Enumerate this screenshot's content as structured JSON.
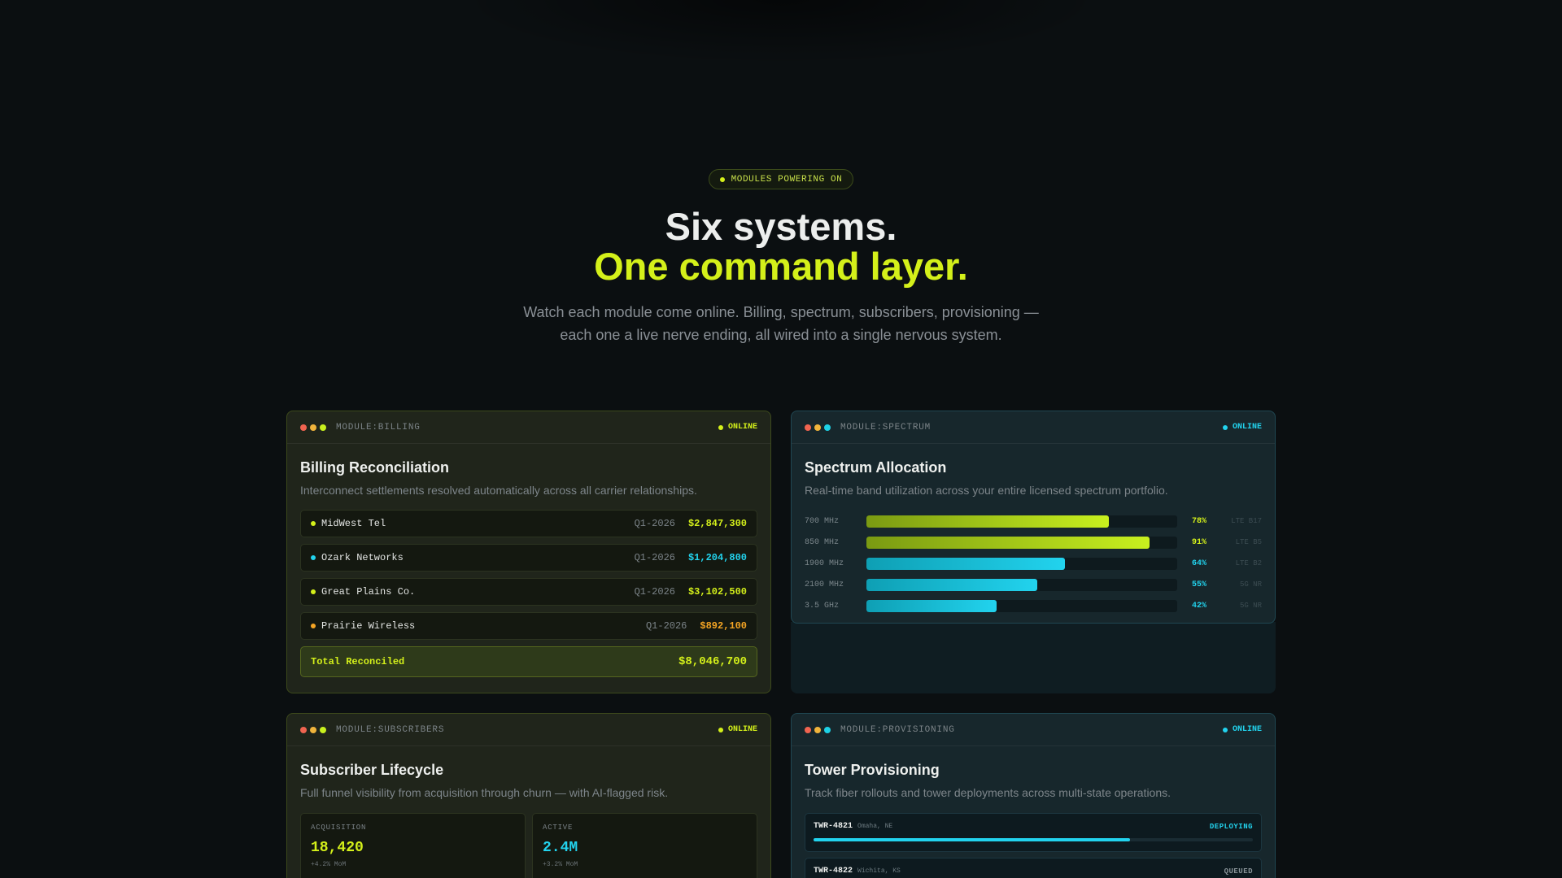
{
  "hero": {
    "pill": "MODULES POWERING ON",
    "title_line1": "Six systems.",
    "title_line2": "One command layer.",
    "subtitle": "Watch each module come online. Billing, spectrum, subscribers, provisioning — each one a live nerve ending, all wired into a single nervous system."
  },
  "colors": {
    "lime": "#d4f01a",
    "cyan": "#22d3ee",
    "orange": "#f5a524",
    "bg": "#0b0f11"
  },
  "billing": {
    "module": "MODULE:BILLING",
    "status": "ONLINE",
    "title": "Billing Reconciliation",
    "description": "Interconnect settlements resolved automatically across all carrier relationships.",
    "rows": [
      {
        "name": "MidWest Tel",
        "period": "Q1-2026",
        "amount": "$2,847,300",
        "color": "#d4f01a"
      },
      {
        "name": "Ozark Networks",
        "period": "Q1-2026",
        "amount": "$1,204,800",
        "color": "#22d3ee"
      },
      {
        "name": "Great Plains Co.",
        "period": "Q1-2026",
        "amount": "$3,102,500",
        "color": "#d4f01a"
      },
      {
        "name": "Prairie Wireless",
        "period": "Q1-2026",
        "amount": "$892,100",
        "color": "#f5a524"
      }
    ],
    "total_label": "Total Reconciled",
    "total_value": "$8,046,700"
  },
  "spectrum": {
    "module": "MODULE:SPECTRUM",
    "status": "ONLINE",
    "title": "Spectrum Allocation",
    "description": "Real-time band utilization across your entire licensed spectrum portfolio.",
    "bands": [
      {
        "band": "700 MHz",
        "pct": 78,
        "label": "78%",
        "tech": "LTE B17",
        "color": "lime"
      },
      {
        "band": "850 MHz",
        "pct": 91,
        "label": "91%",
        "tech": "LTE B5",
        "color": "lime"
      },
      {
        "band": "1900 MHz",
        "pct": 64,
        "label": "64%",
        "tech": "LTE B2",
        "color": "cyan"
      },
      {
        "band": "2100 MHz",
        "pct": 55,
        "label": "55%",
        "tech": "5G NR",
        "color": "cyan"
      },
      {
        "band": "3.5 GHz",
        "pct": 42,
        "label": "42%",
        "tech": "5G NR",
        "color": "cyan"
      }
    ]
  },
  "subscribers": {
    "module": "MODULE:SUBSCRIBERS",
    "status": "ONLINE",
    "title": "Subscriber Lifecycle",
    "description": "Full funnel visibility from acquisition through churn — with AI-flagged risk.",
    "stats": [
      {
        "label": "ACQUISITION",
        "value": "18,420",
        "delta": "+4.2% MoM",
        "color": "#d4f01a"
      },
      {
        "label": "ACTIVE",
        "value": "2.4M",
        "delta": "+3.2% MoM",
        "color": "#22d3ee"
      }
    ]
  },
  "provisioning": {
    "module": "MODULE:PROVISIONING",
    "status": "ONLINE",
    "title": "Tower Provisioning",
    "description": "Track fiber rollouts and tower deployments across multi-state operations.",
    "towers": [
      {
        "id": "TWR-4821",
        "location": "Omaha, NE",
        "status": "DEPLOYING",
        "progress": 0.72,
        "color": "#22d3ee"
      },
      {
        "id": "TWR-4822",
        "location": "Wichita, KS",
        "status": "QUEUED",
        "progress": 0,
        "color": "#8a9499"
      }
    ]
  }
}
